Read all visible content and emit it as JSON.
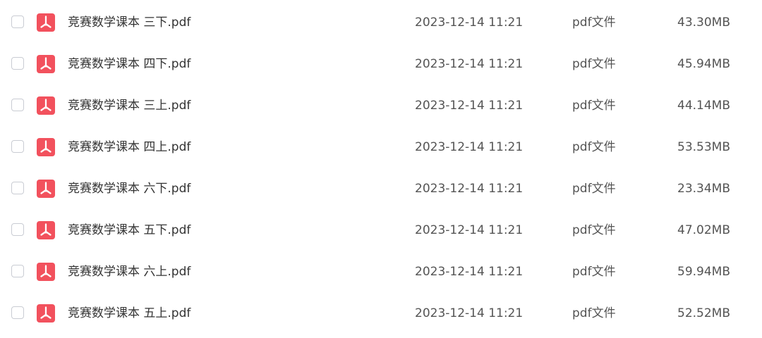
{
  "colors": {
    "pdf_icon": "#f2515d",
    "text_primary": "#333333",
    "text_secondary": "#545454",
    "checkbox_border": "#c9ccd3"
  },
  "files": [
    {
      "name": "竞赛数学课本 三下.pdf",
      "modified": "2023-12-14 11:21",
      "type": "pdf文件",
      "size": "43.30MB",
      "icon": "pdf-file-icon",
      "checked": false
    },
    {
      "name": "竞赛数学课本 四下.pdf",
      "modified": "2023-12-14 11:21",
      "type": "pdf文件",
      "size": "45.94MB",
      "icon": "pdf-file-icon",
      "checked": false
    },
    {
      "name": "竞赛数学课本 三上.pdf",
      "modified": "2023-12-14 11:21",
      "type": "pdf文件",
      "size": "44.14MB",
      "icon": "pdf-file-icon",
      "checked": false
    },
    {
      "name": "竞赛数学课本 四上.pdf",
      "modified": "2023-12-14 11:21",
      "type": "pdf文件",
      "size": "53.53MB",
      "icon": "pdf-file-icon",
      "checked": false
    },
    {
      "name": "竞赛数学课本 六下.pdf",
      "modified": "2023-12-14 11:21",
      "type": "pdf文件",
      "size": "23.34MB",
      "icon": "pdf-file-icon",
      "checked": false
    },
    {
      "name": "竞赛数学课本 五下.pdf",
      "modified": "2023-12-14 11:21",
      "type": "pdf文件",
      "size": "47.02MB",
      "icon": "pdf-file-icon",
      "checked": false
    },
    {
      "name": "竞赛数学课本 六上.pdf",
      "modified": "2023-12-14 11:21",
      "type": "pdf文件",
      "size": "59.94MB",
      "icon": "pdf-file-icon",
      "checked": false
    },
    {
      "name": "竞赛数学课本 五上.pdf",
      "modified": "2023-12-14 11:21",
      "type": "pdf文件",
      "size": "52.52MB",
      "icon": "pdf-file-icon",
      "checked": false
    }
  ]
}
